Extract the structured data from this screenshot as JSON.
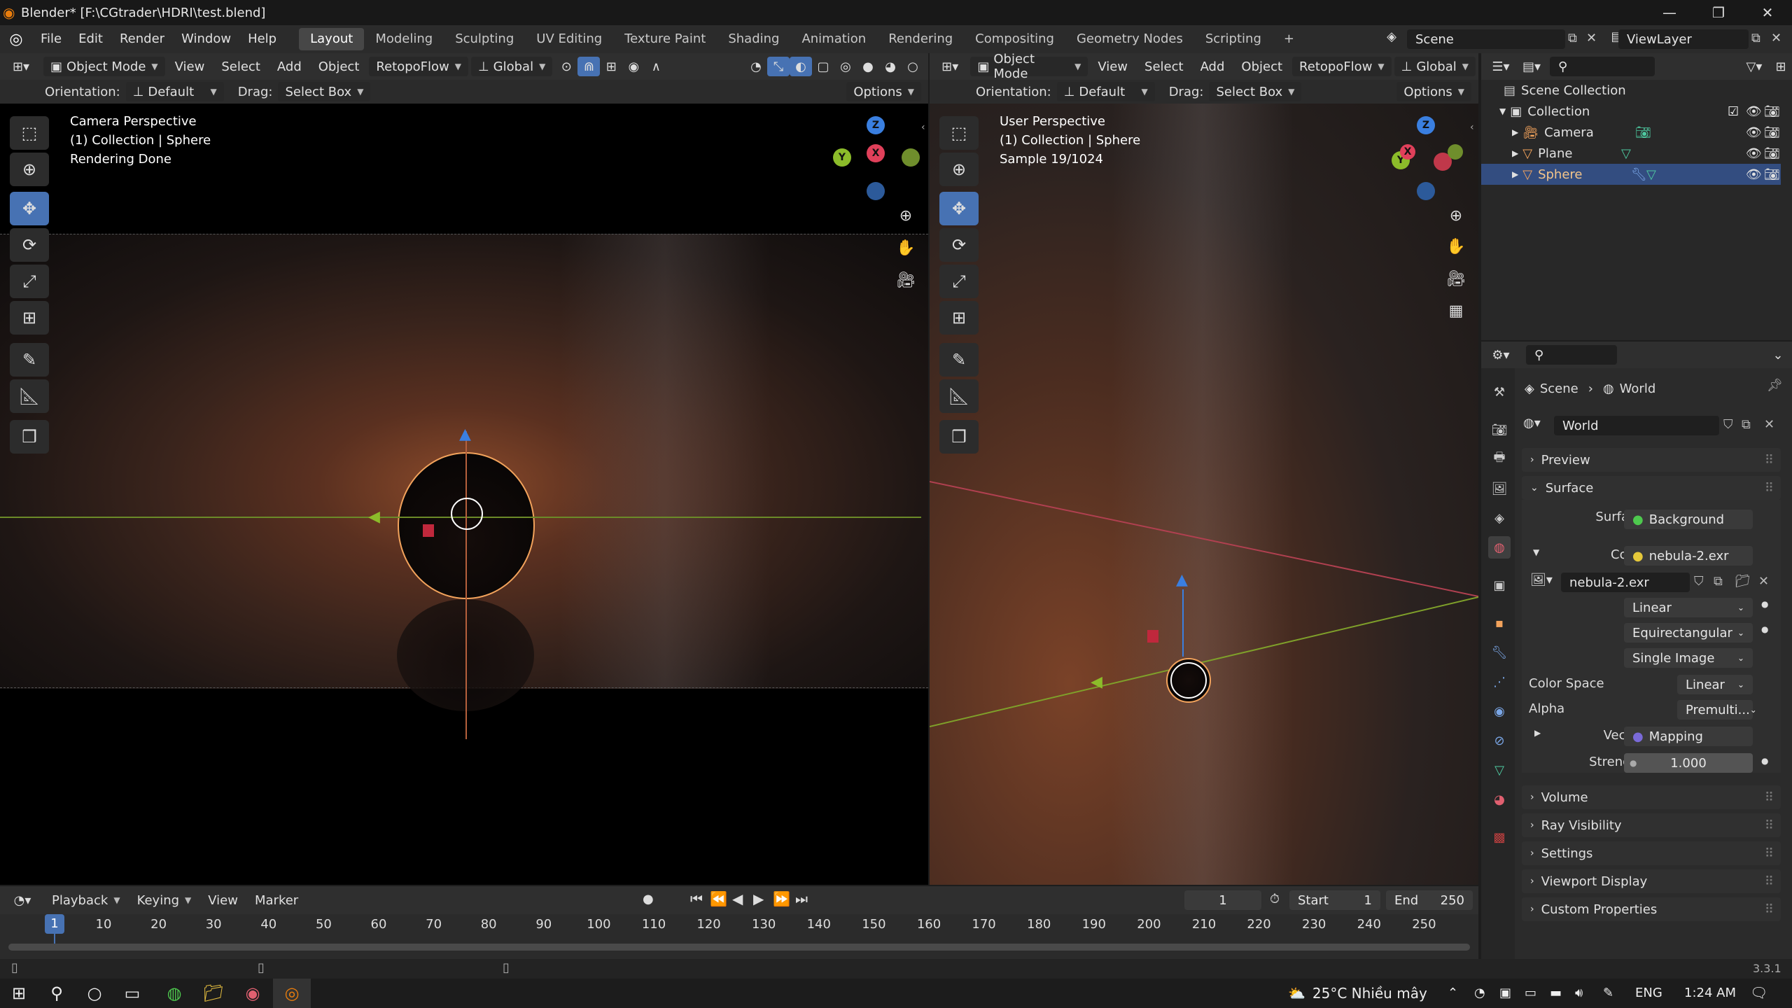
{
  "window": {
    "title": "Blender* [F:\\CGtrader\\HDRI\\test.blend]",
    "minimize": "—",
    "maximize": "❐",
    "close": "✕"
  },
  "menus": [
    "File",
    "Edit",
    "Render",
    "Window",
    "Help"
  ],
  "workspaces": [
    "Layout",
    "Modeling",
    "Sculpting",
    "UV Editing",
    "Texture Paint",
    "Shading",
    "Animation",
    "Rendering",
    "Compositing",
    "Geometry Nodes",
    "Scripting"
  ],
  "active_workspace": "Layout",
  "add_workspace": "+",
  "scene_name": "Scene",
  "view_layer": "ViewLayer",
  "viewport_left": {
    "mode": "Object Mode",
    "menus": [
      "View",
      "Select",
      "Add",
      "Object"
    ],
    "addon": "RetopoFlow",
    "transform_orientation": "Global",
    "orientation_label": "Orientation:",
    "orientation_value": "Default",
    "drag_label": "Drag:",
    "drag_value": "Select Box",
    "options": "Options",
    "overlay_line1": "Camera Perspective",
    "overlay_line2": "(1) Collection | Sphere",
    "overlay_line3": "Rendering Done"
  },
  "viewport_right": {
    "mode": "Object Mode",
    "menus": [
      "View",
      "Select",
      "Add",
      "Object"
    ],
    "addon": "RetopoFlow",
    "transform_orientation": "Global",
    "orientation_label": "Orientation:",
    "orientation_value": "Default",
    "drag_label": "Drag:",
    "drag_value": "Select Box",
    "options": "Options",
    "overlay_line1": "User Perspective",
    "overlay_line2": "(1) Collection | Sphere",
    "overlay_line3": "Sample 19/1024"
  },
  "gizmo_axes": {
    "x": "X",
    "y": "Y",
    "z": "Z"
  },
  "outliner": {
    "root": "Scene Collection",
    "collection": "Collection",
    "items": [
      "Camera",
      "Plane",
      "Sphere"
    ],
    "selected": "Sphere"
  },
  "properties": {
    "breadcrumb_scene": "Scene",
    "breadcrumb_world": "World",
    "world_name": "World",
    "panels": {
      "preview": "Preview",
      "surface": "Surface",
      "volume": "Volume",
      "ray_visibility": "Ray Visibility",
      "settings": "Settings",
      "viewport_display": "Viewport Display",
      "custom_properties": "Custom Properties"
    },
    "surface_label": "Surface",
    "surface_value": "Background",
    "color_label": "Color",
    "color_value": "nebula-2.exr",
    "image_name": "nebula-2.exr",
    "interpolation": "Linear",
    "projection": "Equirectangular",
    "source": "Single Image",
    "color_space_label": "Color Space",
    "color_space_value": "Linear",
    "alpha_label": "Alpha",
    "alpha_value": "Premulti...",
    "vector_label": "Vector",
    "vector_value": "Mapping",
    "strength_label": "Strength",
    "strength_value": "1.000"
  },
  "timeline": {
    "menus": [
      "Playback",
      "Keying",
      "View",
      "Marker"
    ],
    "current_frame": "1",
    "start_label": "Start",
    "start_value": "1",
    "end_label": "End",
    "end_value": "250",
    "playhead": "1",
    "ticks": [
      "10",
      "20",
      "30",
      "40",
      "50",
      "60",
      "70",
      "80",
      "90",
      "100",
      "110",
      "120",
      "130",
      "140",
      "150",
      "160",
      "170",
      "180",
      "190",
      "200",
      "210",
      "220",
      "230",
      "240",
      "250"
    ]
  },
  "version": "3.3.1",
  "taskbar": {
    "weather": "25°C  Nhiều mây",
    "language": "ENG",
    "time": "1:24 AM"
  },
  "colors": {
    "accent_blue": "#4772b3",
    "select_orange": "#f3a35c",
    "axis_x": "#e0405a",
    "axis_y": "#8cbc2a",
    "axis_z": "#3a7fe0"
  }
}
